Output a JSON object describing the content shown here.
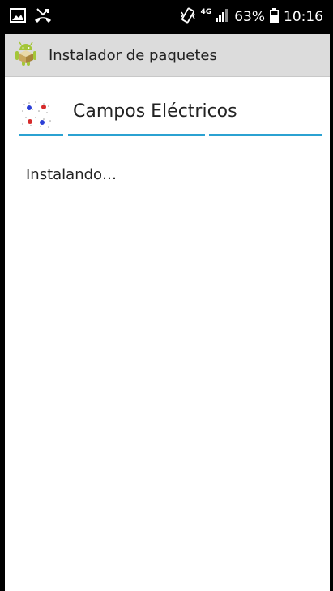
{
  "status_bar": {
    "network_type": "4G",
    "battery_percent": "63%",
    "time": "10:16",
    "icons": [
      "gallery-icon",
      "missed-call-icon",
      "vibrate-icon",
      "signal-icon",
      "battery-icon"
    ]
  },
  "toolbar": {
    "title": "Instalador de paquetes",
    "icon": "android-package-icon"
  },
  "app": {
    "name": "Campos Eléctricos",
    "icon": "electric-fields-app-icon"
  },
  "install": {
    "message": "Instalando…"
  },
  "colors": {
    "accent": "#2ba2d2",
    "android_green": "#a4c639",
    "toolbar_bg": "#dcdcdc",
    "status_bar_bg": "#000000"
  }
}
